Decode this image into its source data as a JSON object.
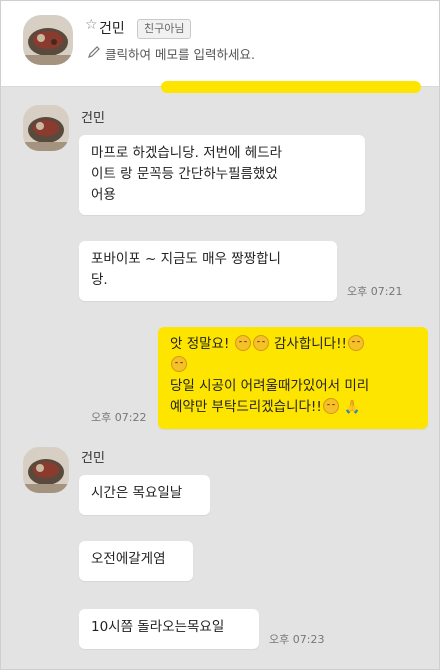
{
  "header": {
    "star": "☆",
    "contact_name": "건민",
    "badge": "친구아님",
    "memo_placeholder": "클릭하여 메모를 입력하세요."
  },
  "messages": {
    "sender_name": "건민",
    "m1": {
      "lines": [
        "마프로 하겠습니당. 저번에 헤드라",
        "이트 랑 문꼭등 간단하누필름했었",
        "어용"
      ]
    },
    "m2": {
      "lines": [
        "포바이포 ~ 지금도 매우 짱짱합니",
        "당."
      ],
      "time": "오후 07:21"
    },
    "m3": {
      "line1": "앗 정말요!",
      "line1b": "감사합니다!!",
      "line3": "당일 시공이 어려울때가있어서 미리",
      "line4": "예약만 부탁드리겠습니다!!",
      "time": "오후 07:22"
    },
    "m4": {
      "text": "시간은 목요일날"
    },
    "m5": {
      "text": "오전에갈게염"
    },
    "m6": {
      "text": "10시쯤 돌라오는목요일",
      "time": "오후 07:23"
    }
  },
  "colors": {
    "my_bubble": "#fee500",
    "their_bubble": "#ffffff",
    "chat_background": "#e3e3e3"
  },
  "icons": [
    "pencil-icon",
    "smile-emoji-icon",
    "folded-hands-emoji-icon",
    "avatar-photo"
  ]
}
